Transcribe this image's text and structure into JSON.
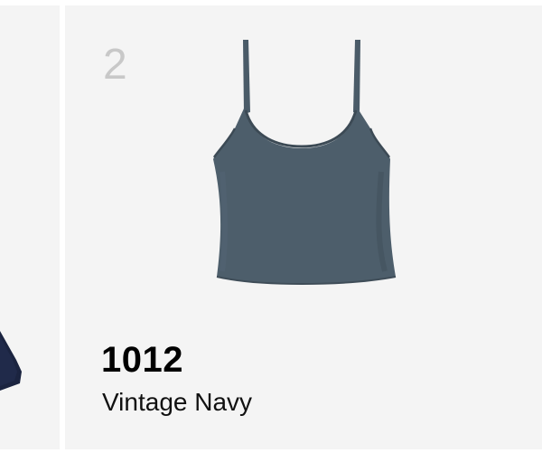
{
  "product": {
    "index": "2",
    "code": "1012",
    "name": "Vintage Navy",
    "image_icon": "tank-top-image",
    "color": "#4a5b68"
  },
  "previous_card": {
    "color": "#1b2440"
  }
}
